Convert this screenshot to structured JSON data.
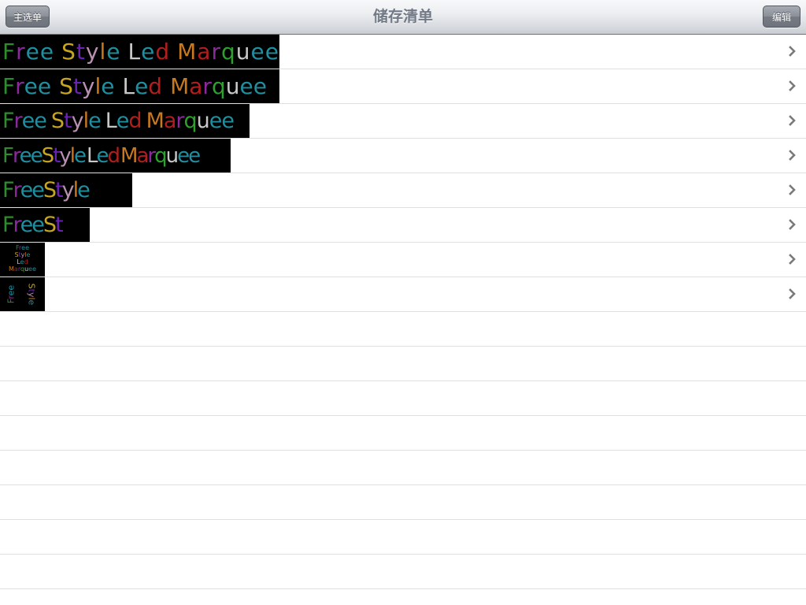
{
  "navbar": {
    "title": "储存清单",
    "left_button": "主选单",
    "right_button": "编辑"
  },
  "palette": {
    "green": "#2e8b2e",
    "purple": "#8a2a9a",
    "teal": "#1f8fa0",
    "yellow": "#c8a51e",
    "violet": "#6a22b0",
    "pink": "#b890b0",
    "orange": "#c8781e",
    "white": "#c8c8c8",
    "red": "#b01e1e",
    "lime": "#2ea02e"
  },
  "rows": [
    {
      "thumbnail_text": "Free Style Led Marquee",
      "layout": "wide-spacing",
      "has_chevron": true
    },
    {
      "thumbnail_text": "Free Style Led Marquee",
      "layout": "normal-spacing",
      "has_chevron": true
    },
    {
      "thumbnail_text": "Free Style Led Marquee",
      "layout": "tight-spacing",
      "has_chevron": true
    },
    {
      "thumbnail_text": "FreeStyle Led Marquee",
      "layout": "tighter-spacing",
      "has_chevron": true
    },
    {
      "thumbnail_text": "FreeStyle",
      "layout": "partial",
      "has_chevron": true
    },
    {
      "thumbnail_text": "FreeSt",
      "layout": "partial",
      "has_chevron": true
    },
    {
      "thumbnail_text": "Free Style Led Marquee",
      "layout": "stacked",
      "has_chevron": true
    },
    {
      "thumbnail_text": "Free Style",
      "layout": "rotated-vertical",
      "has_chevron": true
    },
    {
      "thumbnail_text": "",
      "has_chevron": false
    },
    {
      "thumbnail_text": "",
      "has_chevron": false
    },
    {
      "thumbnail_text": "",
      "has_chevron": false
    },
    {
      "thumbnail_text": "",
      "has_chevron": false
    },
    {
      "thumbnail_text": "",
      "has_chevron": false
    },
    {
      "thumbnail_text": "",
      "has_chevron": false
    },
    {
      "thumbnail_text": "",
      "has_chevron": false
    },
    {
      "thumbnail_text": "",
      "has_chevron": false
    }
  ],
  "icons": {
    "row_accessory": "chevron-right-icon"
  }
}
